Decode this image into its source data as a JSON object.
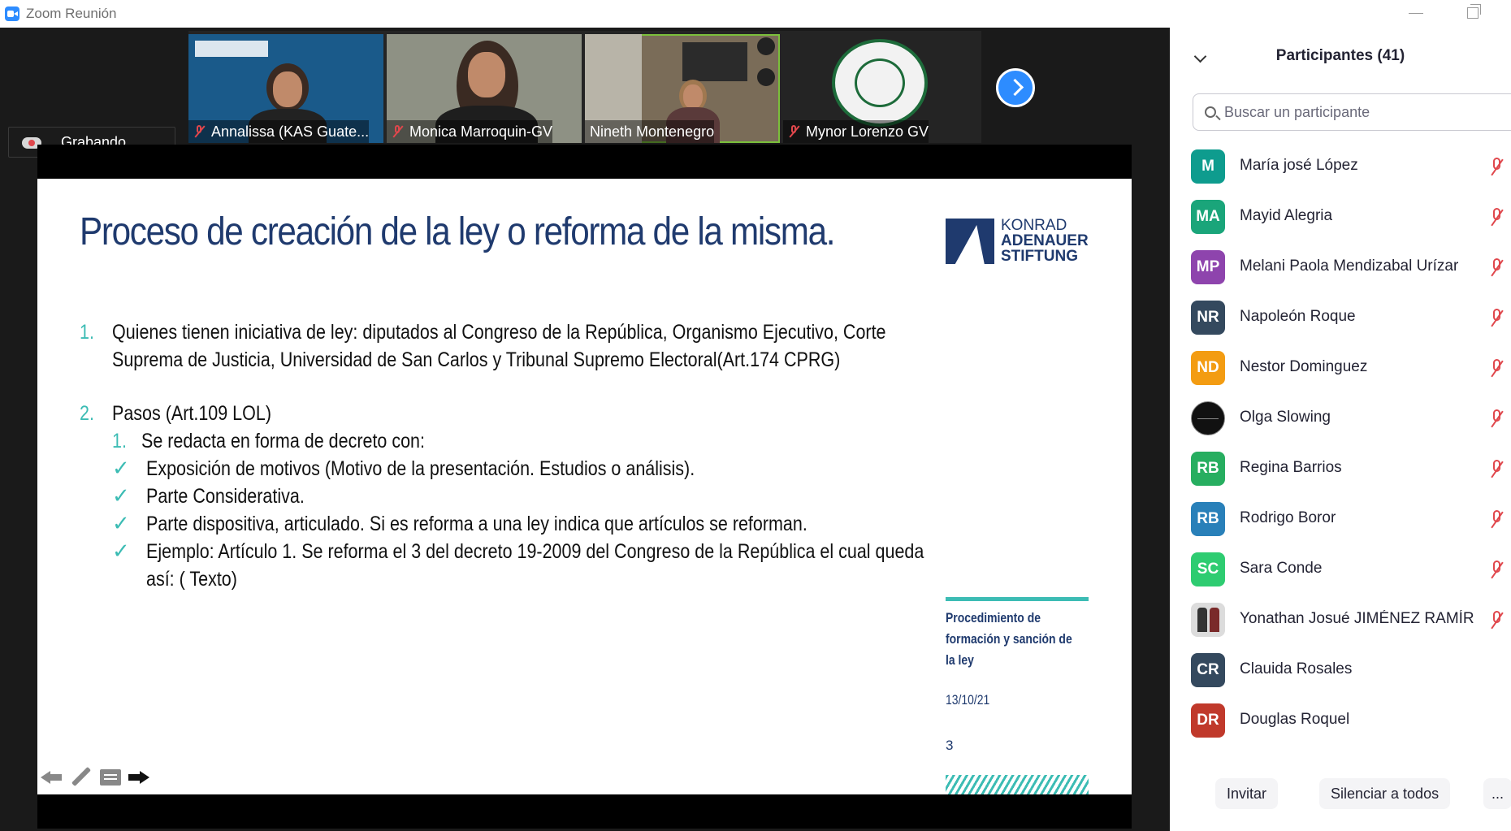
{
  "window": {
    "title": "Zoom Reunión"
  },
  "recording": {
    "label": "Grabando..."
  },
  "thumbnails": [
    {
      "name": "Annalissa (KAS Guate...",
      "muted": true,
      "bg": "#1a5a8a"
    },
    {
      "name": "Monica Marroquin-GV",
      "muted": true,
      "bg": "#8e9184"
    },
    {
      "name": "Nineth Montenegro",
      "muted": false,
      "bg": "#7a6c58"
    },
    {
      "name": "Mynor Lorenzo GV",
      "muted": true,
      "bg": "#242424"
    }
  ],
  "slide": {
    "title": "Proceso de creación de la ley o reforma de la misma.",
    "logo_line1": "KONRAD",
    "logo_line2": "ADENAUER",
    "logo_line3": "STIFTUNG",
    "item1_num": "1.",
    "item1_line1": "Quienes tienen iniciativa de ley: diputados al Congreso de la República, Organismo Ejecutivo, Corte",
    "item1_line2": "Suprema de Justicia, Universidad de San Carlos y Tribunal Supremo Electoral(Art.174 CPRG)",
    "item2_num": "2.",
    "item2_text": "Pasos (Art.109 LOL)",
    "sub1_num": "1.",
    "sub1_text": "Se redacta en forma de decreto con:",
    "check1": "Exposición de motivos (Motivo de la  presentación. Estudios o análisis).",
    "check2": "Parte Considerativa.",
    "check3": "Parte dispositiva, articulado. Si es reforma a una ley indica que artículos se reforman.",
    "check4_line1": "Ejemplo: Artículo 1. Se reforma el 3 del decreto 19-2009 del Congreso de la República el cual queda",
    "check4_line2": "así: ( Texto)",
    "side_title": "Procedimiento de formación y sanción de la ley",
    "side_date": "13/10/21",
    "side_page": "3"
  },
  "panel": {
    "title": "Participantes (41)",
    "search_placeholder": "Buscar un participante",
    "participants": [
      {
        "initials": "M",
        "name": "María josé López",
        "color": "#0e9c8e",
        "muted": true
      },
      {
        "initials": "MA",
        "name": "Mayid Alegria",
        "color": "#1aa57a",
        "muted": true
      },
      {
        "initials": "MP",
        "name": "Melani Paola Mendizabal Urízar",
        "color": "#8e44ad",
        "muted": true
      },
      {
        "initials": "NR",
        "name": "Napoleón Roque",
        "color": "#34495e",
        "muted": true
      },
      {
        "initials": "ND",
        "name": "Nestor Dominguez",
        "color": "#f39c12",
        "muted": true
      },
      {
        "initials": "",
        "name": "Olga Slowing",
        "color": "#111111",
        "muted": true
      },
      {
        "initials": "RB",
        "name": "Regina Barrios",
        "color": "#27ae60",
        "muted": true
      },
      {
        "initials": "RB",
        "name": "Rodrigo Boror",
        "color": "#2980b9",
        "muted": true
      },
      {
        "initials": "SC",
        "name": "Sara Conde",
        "color": "#2ecc71",
        "muted": true
      },
      {
        "initials": "",
        "name": "Yonathan Josué JIMÉNEZ RAMÍR...",
        "color": "#dcdcdc",
        "muted": true
      },
      {
        "initials": "CR",
        "name": "Clauida Rosales",
        "color": "#34495e",
        "muted": false
      },
      {
        "initials": "DR",
        "name": "Douglas Roquel",
        "color": "#c0392b",
        "muted": false
      }
    ],
    "invite_label": "Invitar",
    "mute_all_label": "Silenciar a todos",
    "more_label": "..."
  }
}
